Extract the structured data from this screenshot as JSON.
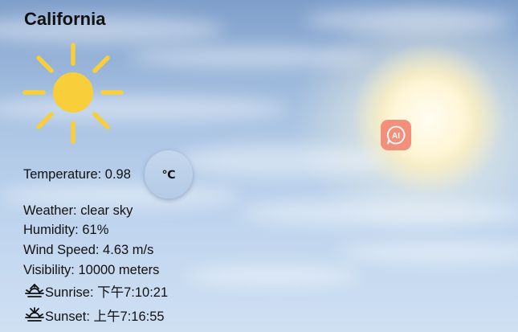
{
  "location": {
    "city": "California"
  },
  "weather_icon": "sun-icon",
  "temperature": {
    "label": "Temperature: 0.98",
    "unit_toggle": "℃"
  },
  "details": {
    "weather": "Weather: clear sky",
    "humidity": "Humidity: 61%",
    "wind_speed": "Wind Speed: 4.63 m/s",
    "visibility": "Visibility: 10000 meters",
    "sunrise": "Sunrise: 下午7:10:21",
    "sunset": "Sunset: 上午7:16:55"
  },
  "ai_badge": {
    "label": "AI",
    "icon": "ai-chat-icon"
  },
  "colors": {
    "sun": "#f8cf3a",
    "ai_badge": "#f3907c",
    "sky_top": "#7f9fcb",
    "sky_bottom": "#cfe0f3"
  }
}
